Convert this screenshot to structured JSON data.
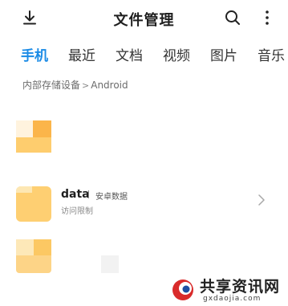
{
  "header": {
    "title": "文件管理",
    "icons": [
      "download-icon",
      "search-icon",
      "more-vertical-icon"
    ]
  },
  "tabs": [
    {
      "label": "手机",
      "active": true
    },
    {
      "label": "最近",
      "active": false
    },
    {
      "label": "文档",
      "active": false
    },
    {
      "label": "视频",
      "active": false
    },
    {
      "label": "图片",
      "active": false
    },
    {
      "label": "音乐",
      "active": false
    }
  ],
  "breadcrumb": {
    "root": "内部存储设备",
    "separator": ">",
    "current": "Android"
  },
  "list": {
    "data_row": {
      "name": "data",
      "description": "安卓数据",
      "subtitle": "访问限制"
    }
  },
  "watermark": {
    "text": "共享资讯网",
    "domain": "gxdaojia.com"
  },
  "colors": {
    "accent": "#1b8be6",
    "folder": "#fecf72"
  }
}
